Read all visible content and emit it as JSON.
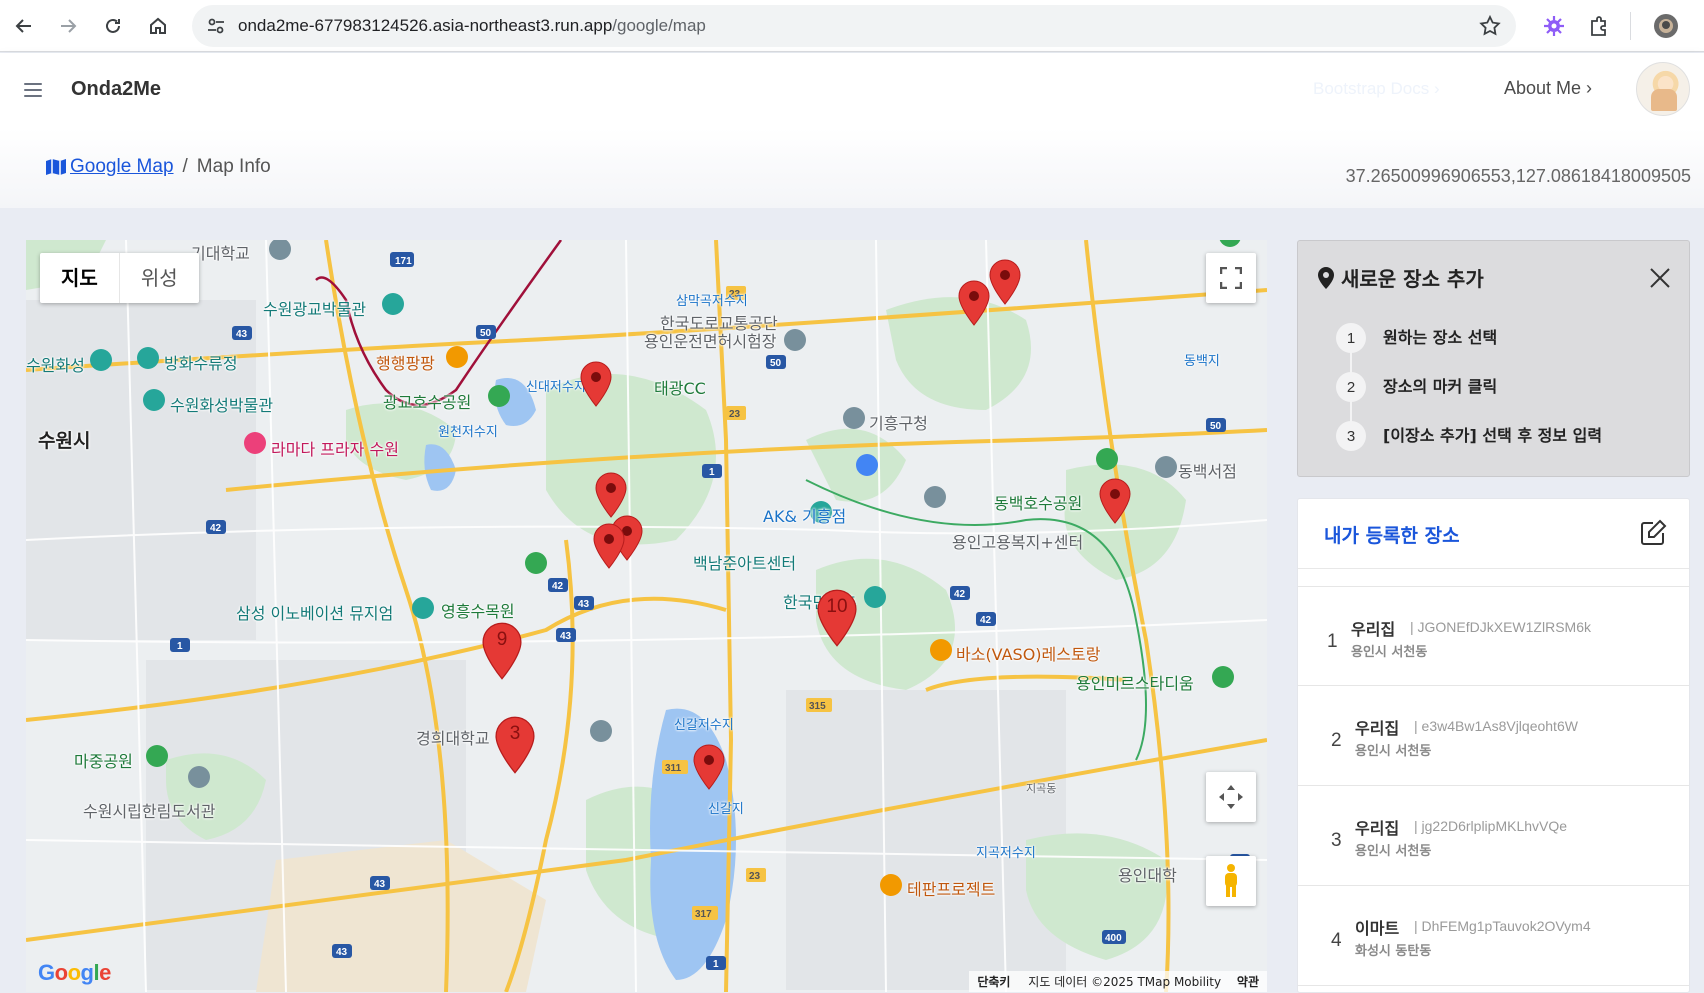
{
  "browser": {
    "url_host": "onda2me-677983124526.asia-northeast3.run.app",
    "url_path": "/google/map",
    "icons": [
      "back-arrow-icon",
      "forward-arrow-icon",
      "reload-icon",
      "home-icon",
      "site-settings-icon",
      "bookmark-star-icon",
      "extension-gear-icon",
      "extensions-puzzle-icon",
      "profile-icon"
    ]
  },
  "header": {
    "brand": "Onda2Me",
    "faint_link": "Bootstrap Docs ›",
    "about_link": "About Me ›"
  },
  "breadcrumb": {
    "root": "Google Map",
    "separator": "/",
    "current": "Map Info"
  },
  "coordinates": "37.26500996906553,127.08618418009505",
  "map": {
    "type_map": "지도",
    "type_satellite": "위성",
    "logo": "Google",
    "attribution": {
      "shortcuts": "단축키",
      "data": "지도 데이터 ©2025 TMap Mobility",
      "terms": "약관"
    },
    "labels": {
      "suwon_si": "수원시",
      "suwon_hwaseong": "수원화성",
      "banghwa": "방화수류정",
      "hwaseong_museum": "수원화성박물관",
      "gwanggyo_museum": "수원광교박물관",
      "haengpang": "행행팡팡",
      "gwanggyo_park": "광교호수공원",
      "wonchun": "원천저수지",
      "singdae": "신대저수지",
      "ramada": "라마다 프라자 수원",
      "taegwang": "태광CC",
      "road_authority_1": "한국도로교통공단",
      "road_authority_2": "용인운전면허시험장",
      "samak": "삼막곡저수지",
      "giheung_office": "기흥구청",
      "ak_giheung": "AK& 기흥점",
      "baekdu": "백남준아트센터",
      "yeongheung": "영흥수목원",
      "samsung": "삼성 이노베이션 뮤지엄",
      "folk_village": "한국민속촌",
      "dongbaek_park": "동백호수공원",
      "dongbaek_library": "동백서점",
      "welfare_center": "용인고용복지+센터",
      "kyunghee": "경희대학교 국제",
      "singal": "신갈저수지",
      "vaso": "바소(VASO)레스토랑",
      "mirs": "용인미르스타디움",
      "majung": "마중공원",
      "library": "수원시립한림도서관",
      "tepan": "테판프로젝트",
      "singalji": "신갈지",
      "jigok": "지곡저수지",
      "yongin_univ": "용인대학",
      "school": "기대학교",
      "jibeok": "지곡동",
      "dongbaek": "동백지"
    },
    "pins": [
      {
        "label": ""
      },
      {
        "label": ""
      },
      {
        "label": ""
      },
      {
        "label": ""
      },
      {
        "label": ""
      },
      {
        "label": ""
      },
      {
        "label": ""
      },
      {
        "label": "9"
      },
      {
        "label": "3"
      },
      {
        "label": "10"
      }
    ]
  },
  "add_place": {
    "title": "새로운 장소 추가",
    "steps": [
      {
        "num": "1",
        "text": "원하는 장소 선택"
      },
      {
        "num": "2",
        "text": "장소의 마커 클릭"
      },
      {
        "num": "3",
        "text": "[이장소 추가] 선택 후 정보 입력"
      }
    ]
  },
  "my_places": {
    "title": "내가 등록한 장소",
    "items": [
      {
        "index": "1",
        "name": "우리집",
        "code": "| JGONEfDJkXEW1ZlRSM6k",
        "location": "용인시 서천동"
      },
      {
        "index": "2",
        "name": "우리집",
        "code": "| e3w4Bw1As8Vjlqeoht6W",
        "location": "용인시 서천동"
      },
      {
        "index": "3",
        "name": "우리집",
        "code": "| jg22D6rlplipMKLhvVQe",
        "location": "용인시 서천동"
      },
      {
        "index": "4",
        "name": "이마트",
        "code": "| DhFEMg1pTauvok2OVym4",
        "location": "화성시 동탄동"
      }
    ]
  },
  "colors": {
    "accent": "#1a56db",
    "pin": "#e53935",
    "road_major": "#f6c343",
    "water": "#9ec5f2",
    "park": "#cfe8cf"
  }
}
